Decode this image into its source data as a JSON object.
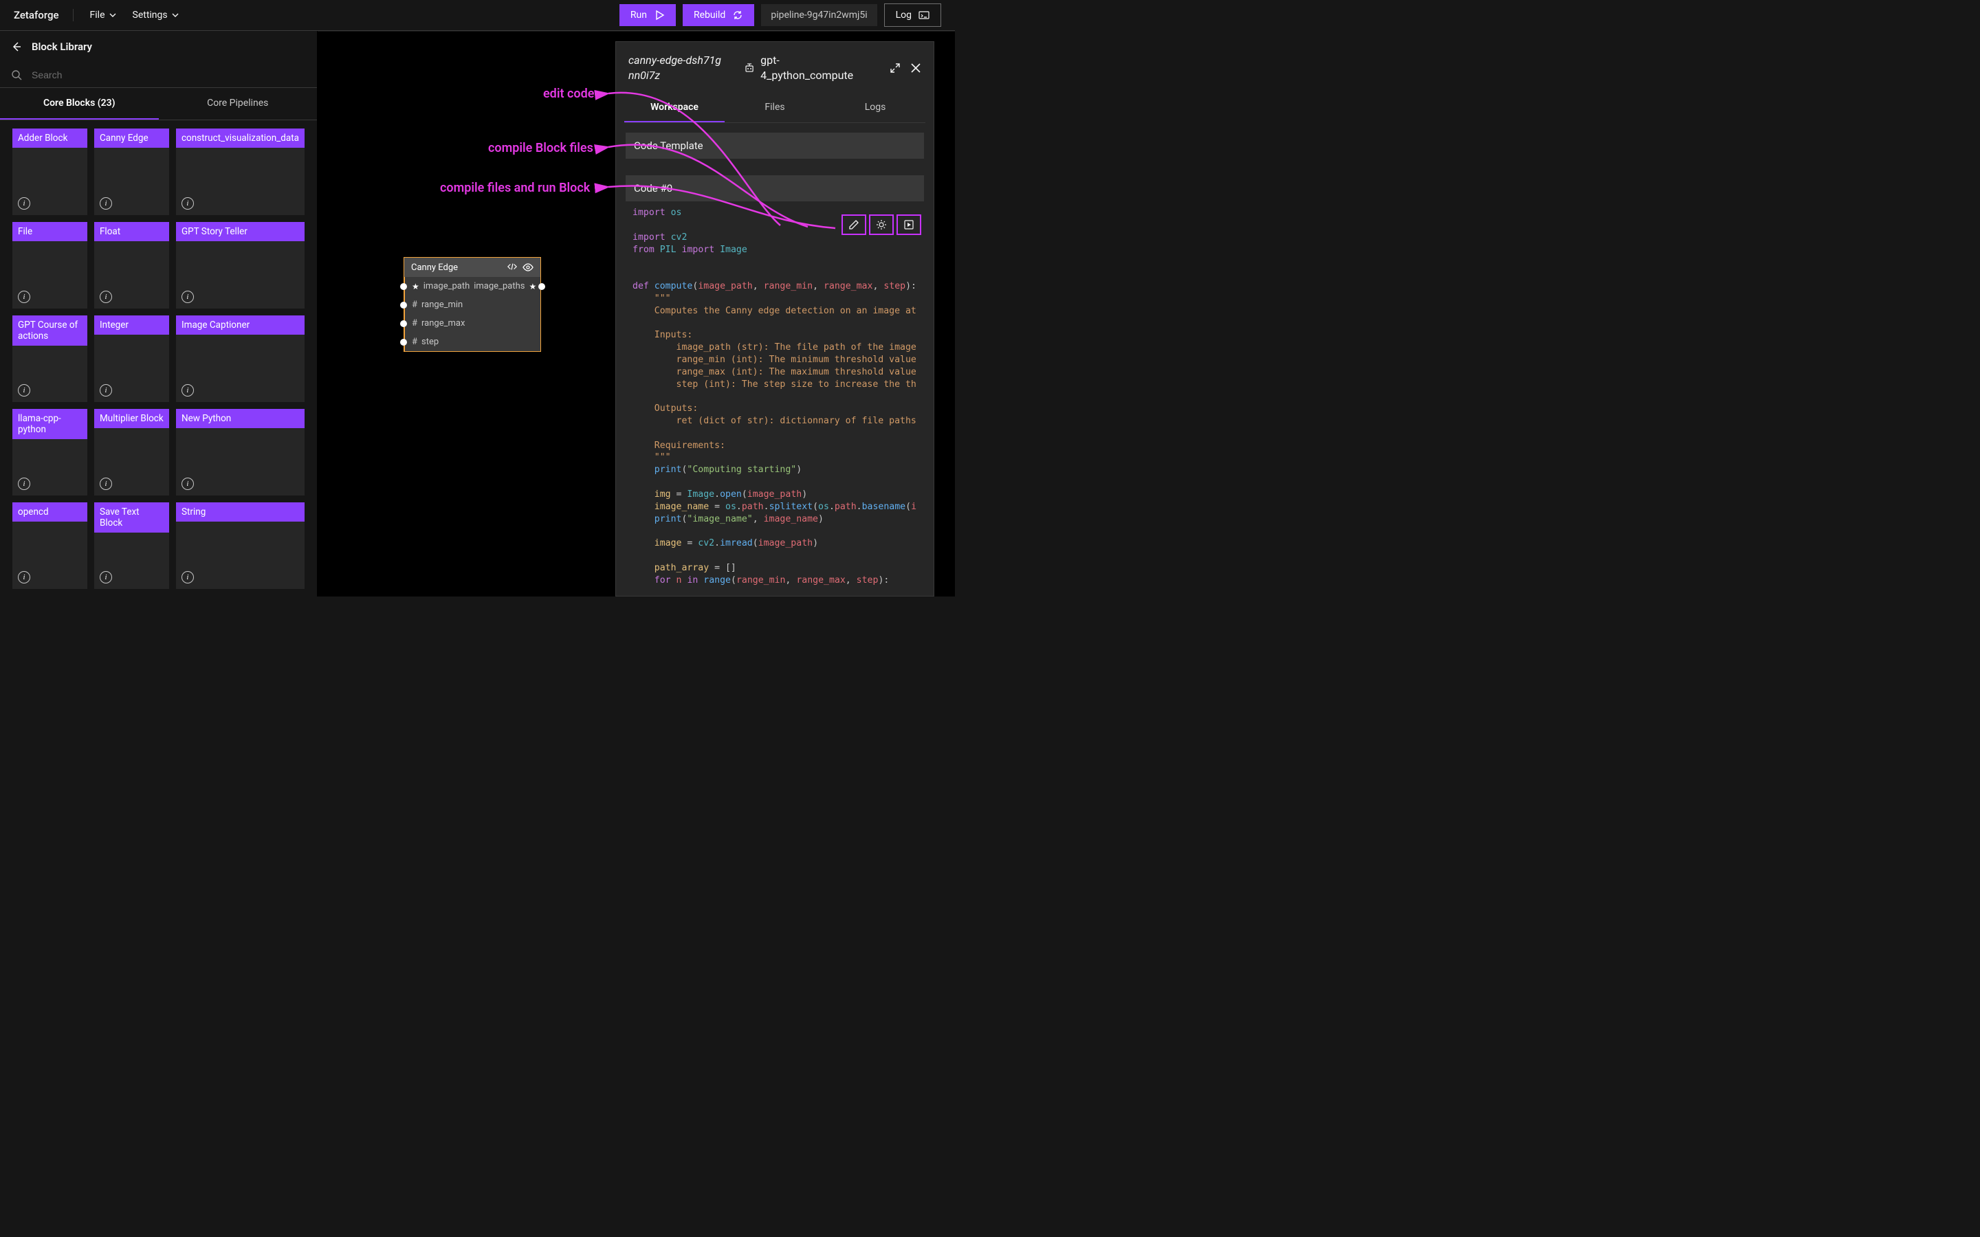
{
  "topbar": {
    "brand": "Zetaforge",
    "menu": [
      "File",
      "Settings"
    ],
    "run": "Run",
    "rebuild": "Rebuild",
    "pipeline_name": "pipeline-9g47in2wmj5i",
    "log": "Log"
  },
  "sidebar": {
    "title": "Block Library",
    "search_placeholder": "Search",
    "tabs": {
      "core_blocks": "Core Blocks (23)",
      "core_pipelines": "Core Pipelines"
    },
    "blocks": [
      "Adder Block",
      "Canny Edge",
      "construct_visualization_data",
      "File",
      "Float",
      "GPT Story Teller",
      "GPT Course of actions",
      "Integer",
      "Image Captioner",
      "llama-cpp-python",
      "Multiplier Block",
      "New Python",
      "opencd",
      "Save Text Block",
      "String"
    ]
  },
  "canvas": {
    "node": {
      "title": "Canny Edge",
      "inputs": [
        {
          "icon": "star",
          "name": "image_path"
        },
        {
          "icon": "hash",
          "name": "range_min"
        },
        {
          "icon": "hash",
          "name": "range_max"
        },
        {
          "icon": "hash",
          "name": "step"
        }
      ],
      "outputs": [
        {
          "icon": "star",
          "name": "image_paths"
        }
      ]
    }
  },
  "annotations": {
    "edit": "edit code",
    "compile": "compile Block files",
    "run": "compile files and run Block"
  },
  "panel": {
    "id1": "canny-edge-dsh71gnn0i7z",
    "id2": "gpt-4_python_compute",
    "tabs": [
      "Workspace",
      "Files",
      "Logs"
    ],
    "template_label": "Code Template",
    "code_label": "Code #0",
    "code_lines": [
      [
        [
          "kw",
          "import"
        ],
        [
          "",
          " "
        ],
        [
          "mod",
          "os"
        ]
      ],
      [],
      [
        [
          "kw",
          "import"
        ],
        [
          "",
          " "
        ],
        [
          "mod",
          "cv2"
        ]
      ],
      [
        [
          "kw",
          "from"
        ],
        [
          "",
          " "
        ],
        [
          "mod",
          "PIL"
        ],
        [
          "",
          " "
        ],
        [
          "kw",
          "import"
        ],
        [
          "",
          " "
        ],
        [
          "mod",
          "Image"
        ]
      ],
      [],
      [],
      [
        [
          "kw",
          "def"
        ],
        [
          "",
          " "
        ],
        [
          "fn",
          "compute"
        ],
        [
          "",
          "("
        ],
        [
          "id",
          "image_path"
        ],
        [
          "",
          ", "
        ],
        [
          "id",
          "range_min"
        ],
        [
          "",
          ", "
        ],
        [
          "id",
          "range_max"
        ],
        [
          "",
          ", "
        ],
        [
          "id",
          "step"
        ],
        [
          "",
          "):"
        ]
      ],
      [
        [
          "",
          "    "
        ],
        [
          "doc",
          "\"\"\""
        ]
      ],
      [
        [
          "",
          "    "
        ],
        [
          "doc",
          "Computes the Canny edge detection on an image at"
        ]
      ],
      [],
      [
        [
          "",
          "    "
        ],
        [
          "doc",
          "Inputs:"
        ]
      ],
      [
        [
          "",
          "        "
        ],
        [
          "doc",
          "image_path (str): The file path of the image"
        ]
      ],
      [
        [
          "",
          "        "
        ],
        [
          "doc",
          "range_min (int): The minimum threshold value"
        ]
      ],
      [
        [
          "",
          "        "
        ],
        [
          "doc",
          "range_max (int): The maximum threshold value"
        ]
      ],
      [
        [
          "",
          "        "
        ],
        [
          "doc",
          "step (int): The step size to increase the th"
        ]
      ],
      [],
      [
        [
          "",
          "    "
        ],
        [
          "doc",
          "Outputs:"
        ]
      ],
      [
        [
          "",
          "        "
        ],
        [
          "doc",
          "ret (dict of str): dictionnary of file paths"
        ]
      ],
      [],
      [
        [
          "",
          "    "
        ],
        [
          "doc",
          "Requirements:"
        ]
      ],
      [
        [
          "",
          "    "
        ],
        [
          "doc",
          "\"\"\""
        ]
      ],
      [
        [
          "",
          "    "
        ],
        [
          "fn",
          "print"
        ],
        [
          "",
          "("
        ],
        [
          "str",
          "\"Computing starting\""
        ],
        [
          "",
          ")"
        ]
      ],
      [],
      [
        [
          "",
          "    "
        ],
        [
          "var",
          "img"
        ],
        [
          "",
          " = "
        ],
        [
          "mod",
          "Image"
        ],
        [
          "",
          "."
        ],
        [
          "fn",
          "open"
        ],
        [
          "",
          "("
        ],
        [
          "id",
          "image_path"
        ],
        [
          "",
          ")"
        ]
      ],
      [
        [
          "",
          "    "
        ],
        [
          "var",
          "image_name"
        ],
        [
          "",
          " = "
        ],
        [
          "mod",
          "os"
        ],
        [
          "",
          "."
        ],
        [
          "id",
          "path"
        ],
        [
          "",
          "."
        ],
        [
          "fn",
          "splitext"
        ],
        [
          "",
          "("
        ],
        [
          "mod",
          "os"
        ],
        [
          "",
          "."
        ],
        [
          "id",
          "path"
        ],
        [
          "",
          "."
        ],
        [
          "fn",
          "basename"
        ],
        [
          "",
          "("
        ],
        [
          "id",
          "i"
        ]
      ],
      [
        [
          "",
          "    "
        ],
        [
          "fn",
          "print"
        ],
        [
          "",
          "("
        ],
        [
          "str",
          "\"image_name\""
        ],
        [
          "",
          ", "
        ],
        [
          "id",
          "image_name"
        ],
        [
          "",
          ")"
        ]
      ],
      [],
      [
        [
          "",
          "    "
        ],
        [
          "var",
          "image"
        ],
        [
          "",
          " = "
        ],
        [
          "mod",
          "cv2"
        ],
        [
          "",
          "."
        ],
        [
          "fn",
          "imread"
        ],
        [
          "",
          "("
        ],
        [
          "id",
          "image_path"
        ],
        [
          "",
          ")"
        ]
      ],
      [],
      [
        [
          "",
          "    "
        ],
        [
          "var",
          "path_array"
        ],
        [
          "",
          " = []"
        ]
      ],
      [
        [
          "",
          "    "
        ],
        [
          "kw",
          "for"
        ],
        [
          "",
          " "
        ],
        [
          "id",
          "n"
        ],
        [
          "",
          " "
        ],
        [
          "kw",
          "in"
        ],
        [
          "",
          " "
        ],
        [
          "fn",
          "range"
        ],
        [
          "",
          "("
        ],
        [
          "id",
          "range_min"
        ],
        [
          "",
          ", "
        ],
        [
          "id",
          "range_max"
        ],
        [
          "",
          ", "
        ],
        [
          "id",
          "step"
        ],
        [
          "",
          "):"
        ]
      ]
    ]
  }
}
